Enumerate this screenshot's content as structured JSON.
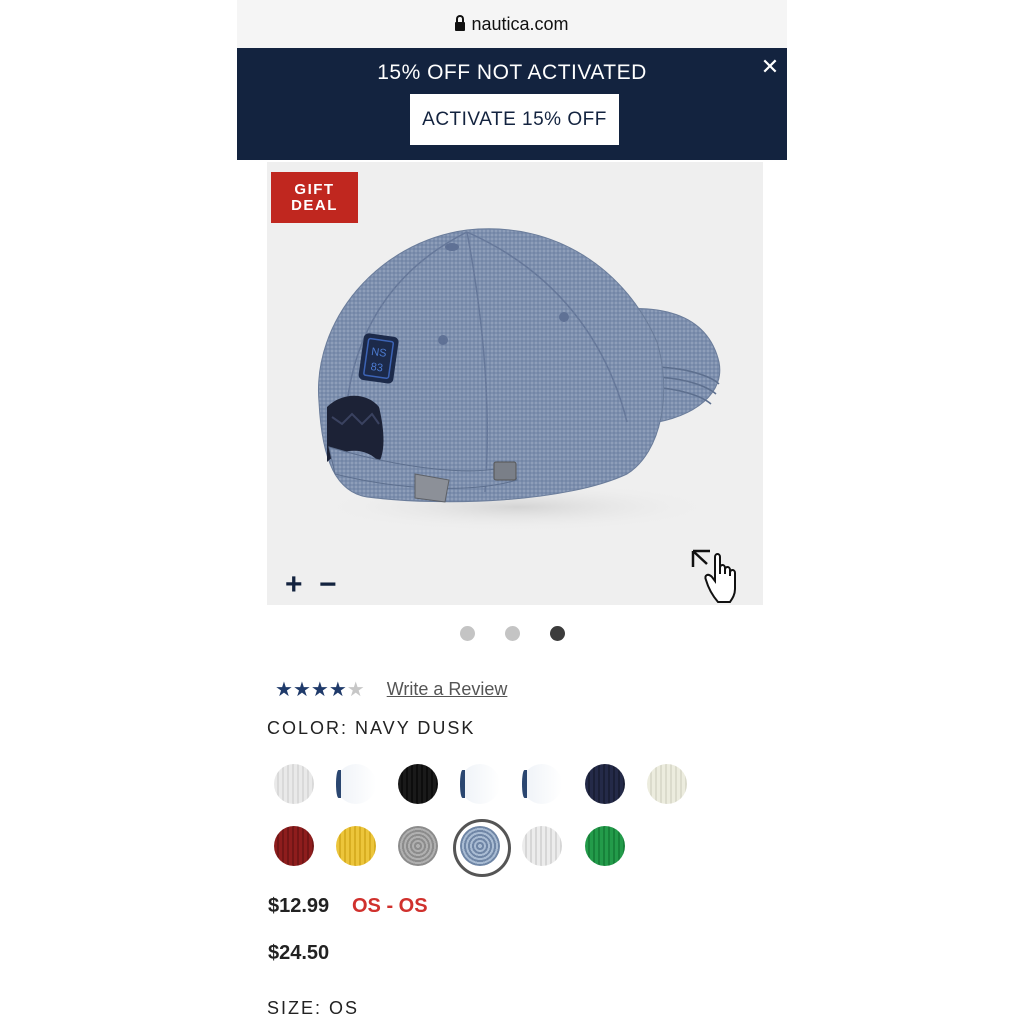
{
  "browser": {
    "url": "nautica.com",
    "lock_icon": "lock-icon"
  },
  "promo": {
    "title": "15% OFF NOT ACTIVATED",
    "button": "ACTIVATE 15% OFF",
    "close": "✕",
    "background": "#13233f"
  },
  "image": {
    "badge_line1": "GIFT",
    "badge_line2": "DEAL",
    "patch_text_1": "NS",
    "patch_text_2": "83",
    "zoom_in": "+",
    "zoom_out": "−",
    "hand_icon": "pan-zoom-hand-icon"
  },
  "carousel": {
    "count": 3,
    "active_index": 3
  },
  "reviews": {
    "rating": 4.5,
    "link": "Write a Review",
    "star_color": "#1f3a6a"
  },
  "color": {
    "label": "COLOR: NAVY DUSK",
    "selected": "chambray"
  },
  "swatches": {
    "row1": [
      "white",
      "partial",
      "black",
      "partial",
      "partial",
      "navy",
      "cream"
    ],
    "row2": [
      "red",
      "yellow",
      "grey",
      "chambray",
      "light-grey",
      "green"
    ]
  },
  "pricing": {
    "sale_price": "$12.99",
    "size_range": "OS - OS",
    "original_price": "$24.50",
    "sale_color": "#d0312d"
  },
  "size": {
    "label": "SIZE: OS"
  }
}
